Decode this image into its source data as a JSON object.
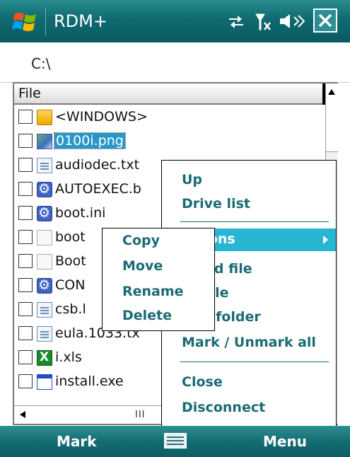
{
  "window": {
    "title": "RDM+"
  },
  "path": "C:\\",
  "list": {
    "header": "File",
    "files": [
      {
        "name": "<WINDOWS>",
        "icon": "folder-icon"
      },
      {
        "name": "0100i.png",
        "icon": "image-file-icon",
        "selected": true
      },
      {
        "name": "audiodec.txt",
        "icon": "text-file-icon"
      },
      {
        "name": "AUTOEXEC.b",
        "icon": "system-file-icon"
      },
      {
        "name": "boot.ini",
        "icon": "system-file-icon"
      },
      {
        "name": "boot",
        "icon": "blank-file-icon"
      },
      {
        "name": "Boot",
        "icon": "blank-file-icon"
      },
      {
        "name": "CON",
        "icon": "system-file-icon"
      },
      {
        "name": "csb.l",
        "icon": "text-file-icon"
      },
      {
        "name": "eula.1033.tx",
        "icon": "text-file-icon"
      },
      {
        "name": "i.xls",
        "icon": "excel-file-icon"
      },
      {
        "name": "install.exe",
        "icon": "exe-file-icon"
      }
    ],
    "hscroll_grip": "III"
  },
  "context_menu": {
    "items": [
      "Up",
      "Drive list",
      "rations",
      "nload file",
      "ad file",
      "te a folder",
      "Mark / Unmark all",
      "Close",
      "Disconnect"
    ]
  },
  "submenu": {
    "items": [
      "Copy",
      "Move",
      "Rename",
      "Delete"
    ]
  },
  "softkeys": {
    "left": "Mark",
    "right": "Menu"
  }
}
